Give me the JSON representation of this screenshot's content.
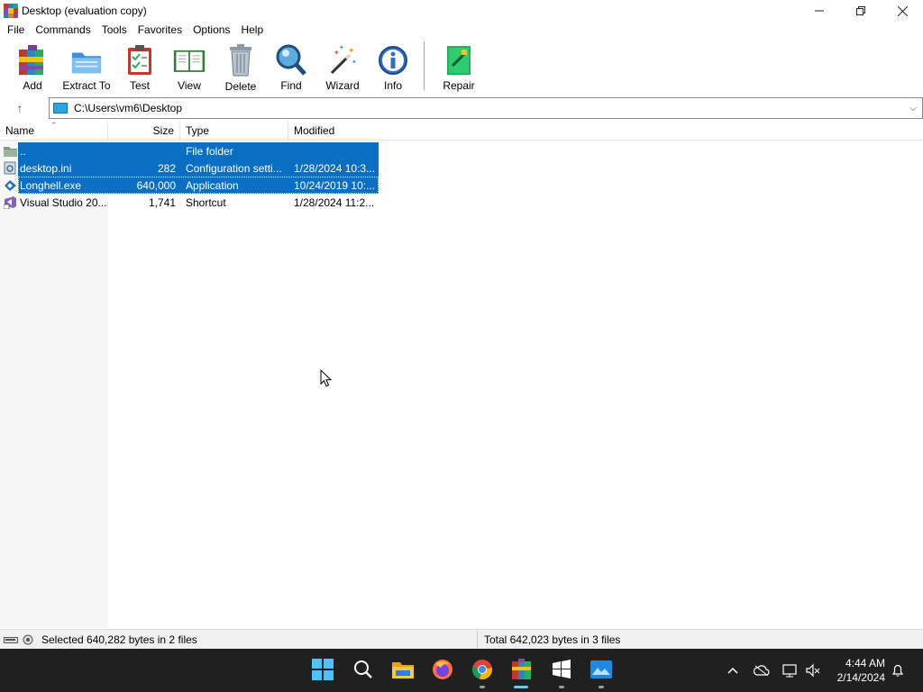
{
  "window": {
    "title": "Desktop (evaluation copy)",
    "controls": {
      "minimize": "—",
      "maximize": "❐",
      "close": "✕"
    }
  },
  "menu": [
    "File",
    "Commands",
    "Tools",
    "Favorites",
    "Options",
    "Help"
  ],
  "toolbar": {
    "buttons": [
      {
        "label": "Add",
        "icon": "add-archive-icon"
      },
      {
        "label": "Extract To",
        "icon": "extract-folder-icon"
      },
      {
        "label": "Test",
        "icon": "test-clipboard-icon"
      },
      {
        "label": "View",
        "icon": "view-book-icon"
      },
      {
        "label": "Delete",
        "icon": "delete-trash-icon"
      },
      {
        "label": "Find",
        "icon": "find-magnifier-icon"
      },
      {
        "label": "Wizard",
        "icon": "wizard-wand-icon"
      },
      {
        "label": "Info",
        "icon": "info-icon"
      }
    ],
    "repair": {
      "label": "Repair",
      "icon": "repair-icon"
    }
  },
  "address": {
    "path": "C:\\Users\\vm6\\Desktop",
    "up_icon": "↑",
    "dropdown_icon": "⌵"
  },
  "columns": {
    "name": "Name",
    "size": "Size",
    "type": "Type",
    "modified": "Modified"
  },
  "files": [
    {
      "name": "..",
      "size": "",
      "type": "File folder",
      "modified": "",
      "icon": "folder-icon",
      "selected": true
    },
    {
      "name": "desktop.ini",
      "size": "282",
      "type": "Configuration setti...",
      "modified": "1/28/2024 10:3...",
      "icon": "config-file-icon",
      "selected": true
    },
    {
      "name": "Longhell.exe",
      "size": "640,000",
      "type": "Application",
      "modified": "10/24/2019 10:...",
      "icon": "application-icon",
      "selected": true
    },
    {
      "name": "Visual Studio 20...",
      "size": "1,741",
      "type": "Shortcut",
      "modified": "1/28/2024 11:2...",
      "icon": "visual-studio-icon",
      "selected": false
    }
  ],
  "status": {
    "selected": "Selected 640,282 bytes in 2 files",
    "total": "Total 642,023 bytes in 3 files"
  },
  "taskbar": {
    "apps": [
      "start",
      "search",
      "file-explorer",
      "firefox",
      "chrome",
      "winrar",
      "setup",
      "photos"
    ],
    "time": "4:44 AM",
    "date": "2/14/2024"
  },
  "colors": {
    "selection": "#0a6fc2",
    "taskbar": "#202020"
  }
}
